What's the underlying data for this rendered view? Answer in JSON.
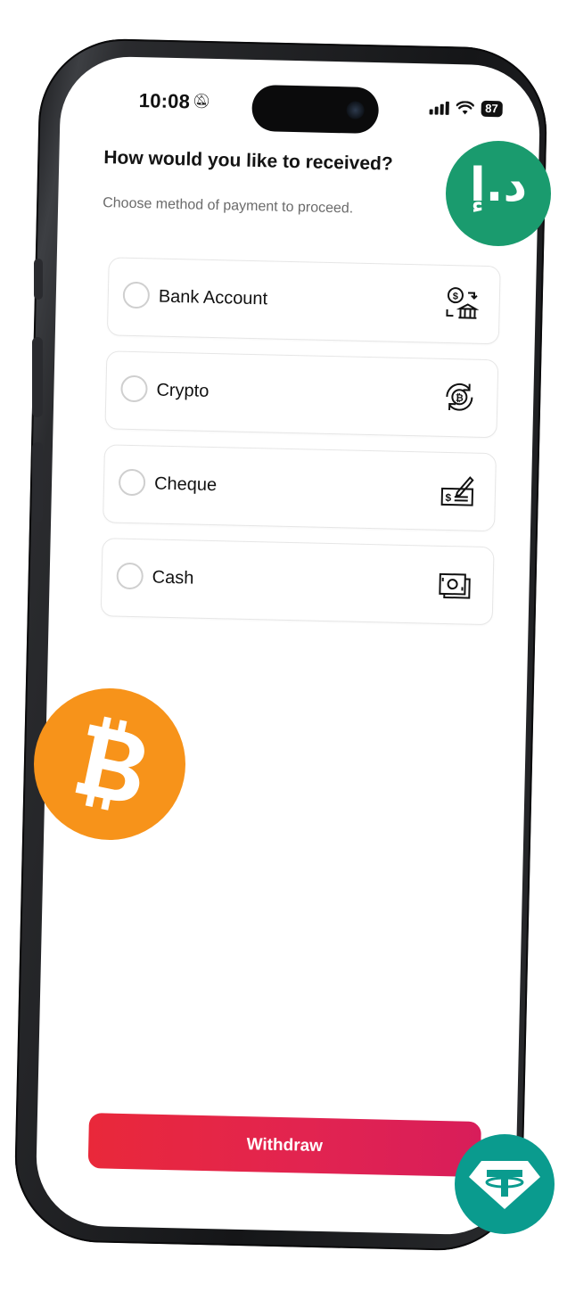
{
  "status_bar": {
    "time": "10:08",
    "battery": "87"
  },
  "screen": {
    "heading": "How would you like to received?",
    "subheading": "Choose method of payment to proceed."
  },
  "options": [
    {
      "label": "Bank Account",
      "icon": "bank-transfer-icon",
      "selected": false
    },
    {
      "label": "Crypto",
      "icon": "crypto-exchange-icon",
      "selected": false
    },
    {
      "label": "Cheque",
      "icon": "cheque-icon",
      "selected": false
    },
    {
      "label": "Cash",
      "icon": "cash-icon",
      "selected": false
    }
  ],
  "actions": {
    "withdraw_label": "Withdraw"
  },
  "badges": {
    "aed": {
      "text": "د.إ",
      "color": "#1a9b6e"
    },
    "btc": {
      "color": "#f7931a"
    },
    "usdt": {
      "color": "#0a9b8e"
    }
  },
  "colors": {
    "accent_start": "#e9283a",
    "accent_end": "#d81d5a"
  }
}
